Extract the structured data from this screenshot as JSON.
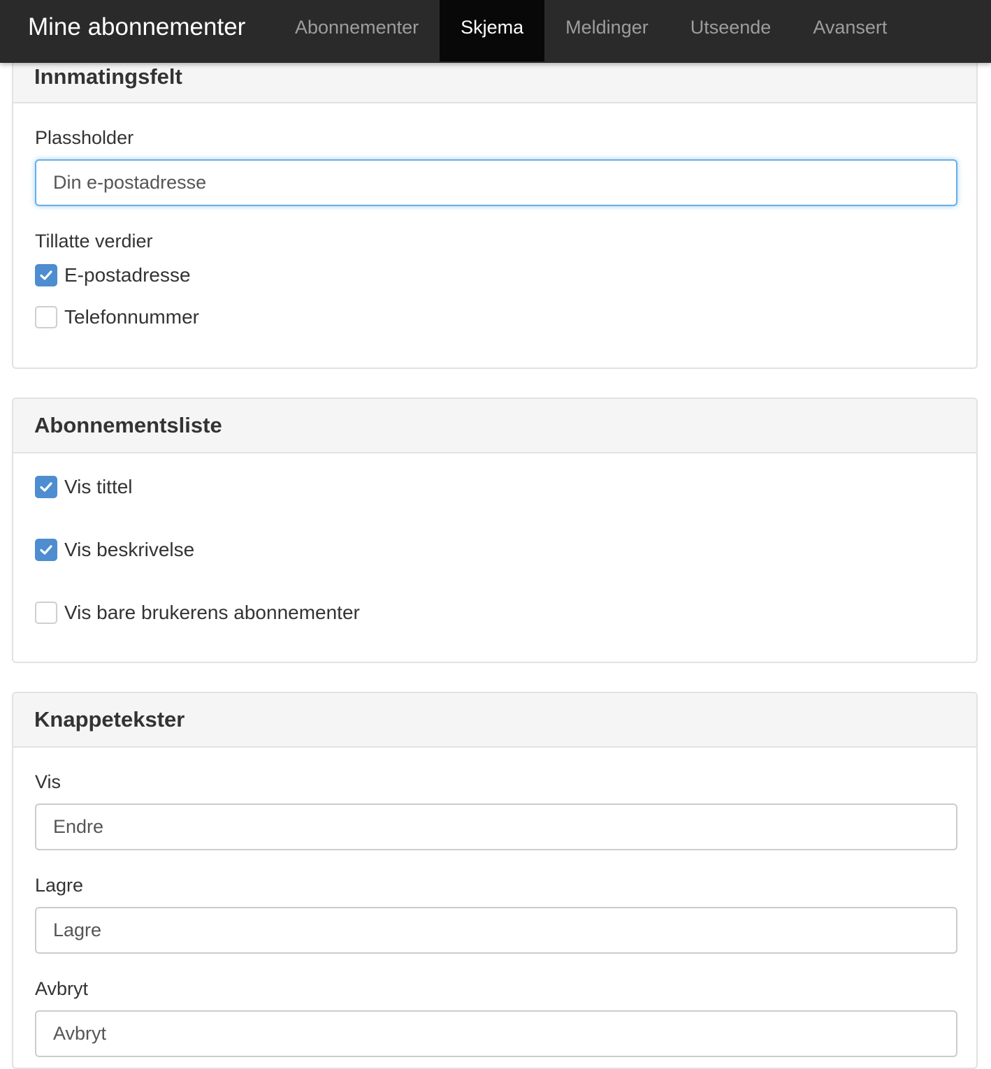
{
  "navbar": {
    "brand": "Mine abonnementer",
    "tabs": [
      {
        "label": "Abonnementer",
        "active": false
      },
      {
        "label": "Skjema",
        "active": true
      },
      {
        "label": "Meldinger",
        "active": false
      },
      {
        "label": "Utseende",
        "active": false
      },
      {
        "label": "Avansert",
        "active": false
      }
    ]
  },
  "input_panel": {
    "heading": "Innmatingsfelt",
    "placeholder_label": "Plassholder",
    "placeholder_value": "Din e-postadresse",
    "allowed_label": "Tillatte verdier",
    "options": [
      {
        "label": "E-postadresse",
        "checked": true
      },
      {
        "label": "Telefonnummer",
        "checked": false
      }
    ]
  },
  "list_panel": {
    "heading": "Abonnementsliste",
    "options": [
      {
        "label": "Vis tittel",
        "checked": true
      },
      {
        "label": "Vis beskrivelse",
        "checked": true
      },
      {
        "label": "Vis bare brukerens abonnementer",
        "checked": false
      }
    ]
  },
  "button_panel": {
    "heading": "Knappetekster",
    "fields": [
      {
        "label": "Vis",
        "value": "Endre"
      },
      {
        "label": "Lagre",
        "value": "Lagre"
      },
      {
        "label": "Avbryt",
        "value": "Avbryt"
      }
    ]
  },
  "colors": {
    "navbar_bg": "#2a2a2a",
    "active_tab_bg": "#080808",
    "checkbox_checked": "#4d8dd0",
    "focus_border": "#66afe9"
  }
}
